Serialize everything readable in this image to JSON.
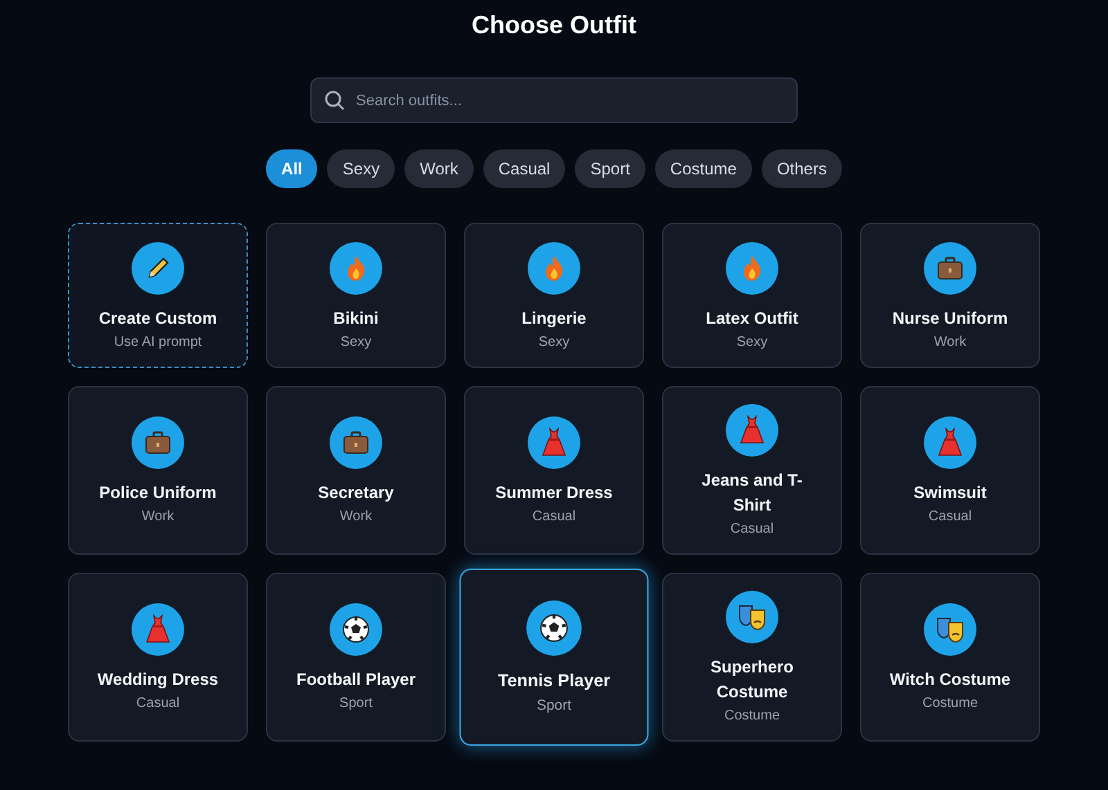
{
  "title": "Choose Outfit",
  "search": {
    "placeholder": "Search outfits..."
  },
  "filters": [
    {
      "label": "All",
      "selected": true
    },
    {
      "label": "Sexy",
      "selected": false
    },
    {
      "label": "Work",
      "selected": false
    },
    {
      "label": "Casual",
      "selected": false
    },
    {
      "label": "Sport",
      "selected": false
    },
    {
      "label": "Costume",
      "selected": false
    },
    {
      "label": "Others",
      "selected": false
    }
  ],
  "outfits": [
    {
      "kind": "custom",
      "name": "Create Custom",
      "category": "Use AI prompt",
      "selected": false
    },
    {
      "kind": "sexy",
      "name": "Bikini",
      "category": "Sexy",
      "selected": false
    },
    {
      "kind": "sexy",
      "name": "Lingerie",
      "category": "Sexy",
      "selected": false
    },
    {
      "kind": "sexy",
      "name": "Latex Outfit",
      "category": "Sexy",
      "selected": false
    },
    {
      "kind": "work",
      "name": "Nurse Uniform",
      "category": "Work",
      "selected": false
    },
    {
      "kind": "work",
      "name": "Police Uniform",
      "category": "Work",
      "selected": false
    },
    {
      "kind": "work",
      "name": "Secretary",
      "category": "Work",
      "selected": false
    },
    {
      "kind": "casual",
      "name": "Summer Dress",
      "category": "Casual",
      "selected": false
    },
    {
      "kind": "casual",
      "name": "Jeans and T-Shirt",
      "category": "Casual",
      "selected": false
    },
    {
      "kind": "casual",
      "name": "Swimsuit",
      "category": "Casual",
      "selected": false
    },
    {
      "kind": "casual",
      "name": "Wedding Dress",
      "category": "Casual",
      "selected": false
    },
    {
      "kind": "sport",
      "name": "Football Player",
      "category": "Sport",
      "selected": false
    },
    {
      "kind": "sport",
      "name": "Tennis Player",
      "category": "Sport",
      "selected": true
    },
    {
      "kind": "costume",
      "name": "Superhero Costume",
      "category": "Costume",
      "selected": false
    },
    {
      "kind": "costume",
      "name": "Witch Costume",
      "category": "Costume",
      "selected": false
    }
  ]
}
